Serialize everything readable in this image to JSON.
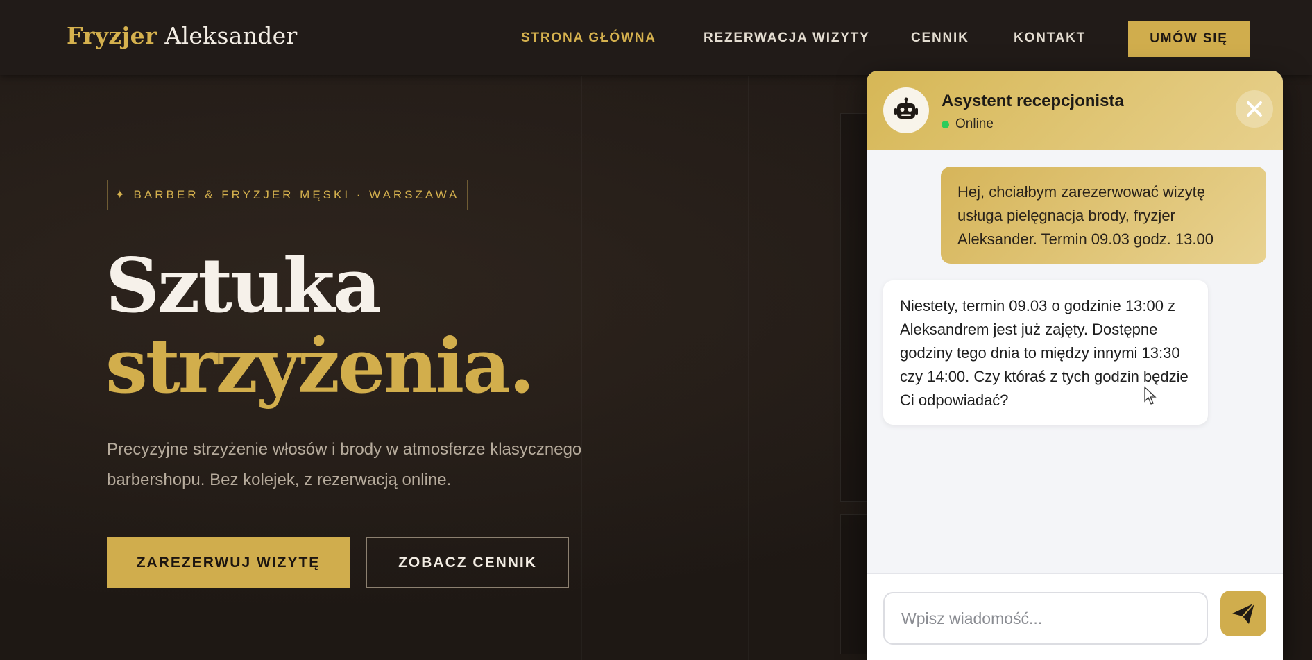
{
  "brand": {
    "first": "Fryzjer",
    "second": "Aleksander"
  },
  "nav": {
    "items": [
      {
        "label": "STRONA GŁÓWNA",
        "active": true
      },
      {
        "label": "REZERWACJA WIZYTY",
        "active": false
      },
      {
        "label": "CENNIK",
        "active": false
      },
      {
        "label": "KONTAKT",
        "active": false
      }
    ],
    "cta": "UMÓW SIĘ"
  },
  "hero": {
    "badge": "✦ BARBER & FRYZJER MĘSKI · WARSZAWA",
    "title_line1": "Sztuka",
    "title_line2": "strzyżenia.",
    "description": "Precyzyjne strzyżenie włosów i brody w atmosferze klasycznego barbershopu. Bez kolejek, z rezerwacją online.",
    "primary_button": "ZAREZERWUJ WIZYTĘ",
    "secondary_button": "ZOBACZ CENNIK"
  },
  "chat": {
    "title": "Asystent recepcjonista",
    "status": "Online",
    "avatar_icon": "robot-icon",
    "close_icon": "close-icon",
    "messages": [
      {
        "from": "user",
        "text": "Hej, chciałbym zarezerwować wizytę usługa pielęgnacja brody, fryzjer Aleksander. Termin 09.03 godz. 13.00"
      },
      {
        "from": "bot",
        "text": "Niestety, termin 09.03 o godzinie 13:00 z Aleksandrem jest już zajęty. Dostępne godziny tego dnia to między innymi 13:30 czy 14:00. Czy któraś z tych godzin będzie Ci odpowiadać?"
      }
    ],
    "input_placeholder": "Wpisz wiadomość...",
    "send_icon": "send-icon"
  },
  "colors": {
    "gold": "#d0ad4d",
    "background": "#1f1915",
    "online": "#2ecc5a"
  }
}
